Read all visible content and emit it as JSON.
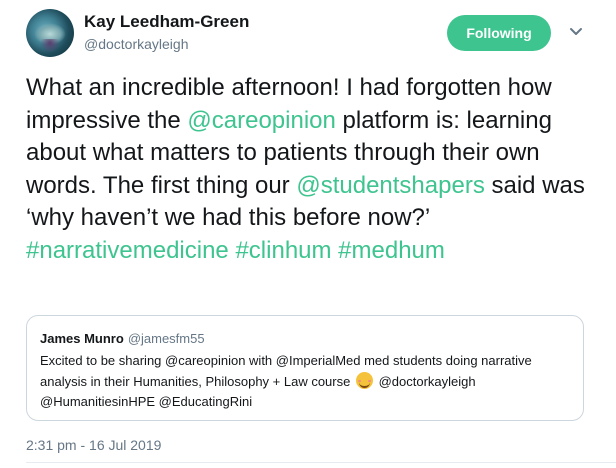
{
  "author": {
    "name": "Kay Leedham-Green",
    "handle": "@doctorkayleigh",
    "follow_label": "Following"
  },
  "tweet": {
    "segments": [
      {
        "text": "What an incredible afternoon! I had forgotten how impressive the ",
        "link": false
      },
      {
        "text": "@careopinion",
        "link": true
      },
      {
        "text": " platform is: learning about what matters to patients through their own words. The first thing our ",
        "link": false
      },
      {
        "text": "@studentshapers",
        "link": true
      },
      {
        "text": " said was ‘why haven’t we had this before now?’ ",
        "link": false
      },
      {
        "text": "#narrativemedicine",
        "link": true
      },
      {
        "text": " ",
        "link": false
      },
      {
        "text": "#clinhum",
        "link": true
      },
      {
        "text": " ",
        "link": false
      },
      {
        "text": "#medhum",
        "link": true
      }
    ]
  },
  "quoted": {
    "name": "James Munro",
    "handle": "@jamesfm55",
    "text_before_emoji": "Excited to be sharing @careopinion with @ImperialMed med students doing narrative analysis in their Humanities, Philosophy + Law course",
    "emoji": "smiling-face-emoji",
    "text_after_emoji": "@doctorkayleigh @HumanitiesinHPE @EducatingRini"
  },
  "timestamp": "2:31 pm - 16 Jul 2019",
  "colors": {
    "accent": "#3ec48f",
    "text": "#14171a",
    "muted": "#657786",
    "border": "#ccd6dd"
  }
}
